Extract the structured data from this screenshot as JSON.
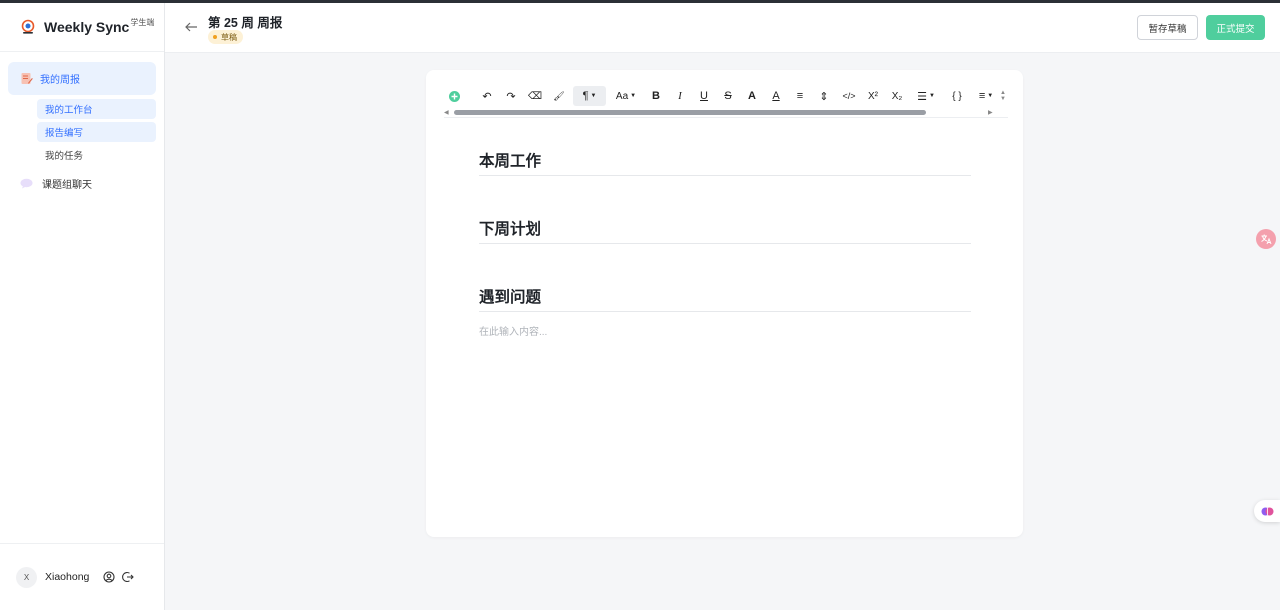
{
  "app": {
    "brand_title": "Weekly Sync",
    "brand_sub": "学生端"
  },
  "sidebar": {
    "groups": [
      {
        "label": "我的周报",
        "items": [
          {
            "label": "我的工作台",
            "active": true
          },
          {
            "label": "报告编写",
            "active": true
          },
          {
            "label": "我的任务",
            "active": false
          }
        ]
      },
      {
        "label": "课题组聊天"
      }
    ],
    "user": {
      "avatar_initial": "X",
      "name": "Xiaohong"
    }
  },
  "header": {
    "title": "第 25 周 周报",
    "status_badge": "草稿",
    "save_draft_label": "暂存草稿",
    "submit_label": "正式提交"
  },
  "editor": {
    "toolbar": [
      {
        "name": "add",
        "glyph": "+"
      },
      {
        "name": "undo",
        "glyph": "↶"
      },
      {
        "name": "redo",
        "glyph": "↷"
      },
      {
        "name": "clear-format",
        "glyph": "⌫"
      },
      {
        "name": "format-painter",
        "glyph": "🖌"
      },
      {
        "name": "paragraph",
        "glyph": "¶"
      },
      {
        "name": "font-size",
        "glyph": "Aa"
      },
      {
        "name": "bold",
        "glyph": "B"
      },
      {
        "name": "italic",
        "glyph": "I"
      },
      {
        "name": "underline",
        "glyph": "U"
      },
      {
        "name": "strikethrough",
        "glyph": "S"
      },
      {
        "name": "highlight",
        "glyph": "A"
      },
      {
        "name": "font-color",
        "glyph": "A"
      },
      {
        "name": "line-height",
        "glyph": "≡"
      },
      {
        "name": "indent",
        "glyph": "⇕"
      },
      {
        "name": "code",
        "glyph": "</>"
      },
      {
        "name": "superscript",
        "glyph": "X²"
      },
      {
        "name": "subscript",
        "glyph": "X₂"
      },
      {
        "name": "list",
        "glyph": "☰"
      },
      {
        "name": "code-block",
        "glyph": "{ }"
      },
      {
        "name": "align",
        "glyph": "≡"
      }
    ],
    "sections": [
      "本周工作",
      "下周计划",
      "遇到问题"
    ],
    "placeholder": "在此输入内容..."
  },
  "colors": {
    "accent": "#3370ff",
    "submit": "#4fce9d",
    "draft_badge_bg": "#fdf1d6"
  }
}
